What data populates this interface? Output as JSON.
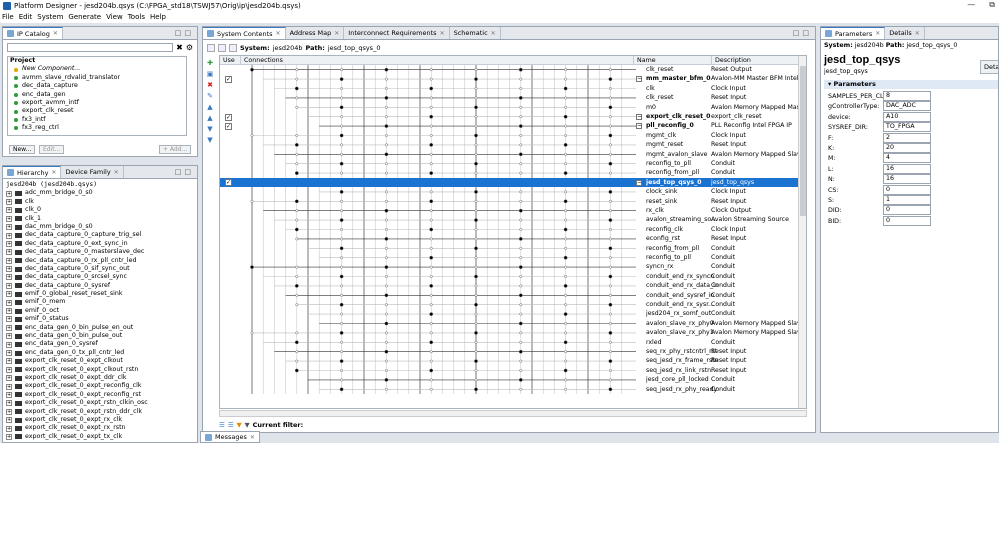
{
  "window": {
    "title": "Platform Designer - jesd204b.qsys (C:\\FPGA_std18\\TSWJ57\\Orig\\ip\\jesd204b.qsys)"
  },
  "menu": [
    "File",
    "Edit",
    "System",
    "Generate",
    "View",
    "Tools",
    "Help"
  ],
  "ip_catalog": {
    "tab": "IP Catalog",
    "search_value": "",
    "project_label": "Project",
    "new_component": "New Component...",
    "items": [
      "avmm_slave_rdvalid_translator",
      "dec_data_capture",
      "enc_data_gen",
      "export_avmm_intf",
      "export_clk_reset",
      "fx3_intf",
      "fx3_reg_ctrl"
    ],
    "buttons": {
      "new": "New...",
      "edit": "Edit...",
      "add": "+ Add..."
    }
  },
  "hierarchy": {
    "tabs": [
      "Hierarchy",
      "Device Family"
    ],
    "root": "jesd204b (jesd204b.qsys)",
    "items": [
      "adc_mm_bridge_0_s0",
      "clk",
      "clk_0",
      "clk_1",
      "dac_mm_bridge_0_s0",
      "dec_data_capture_0_capture_trig_sel",
      "dec_data_capture_0_ext_sync_in",
      "dec_data_capture_0_masterslave_dec",
      "dec_data_capture_0_rx_pll_cntr_led",
      "dec_data_capture_0_sif_sync_out",
      "dec_data_capture_0_srcsel_sync",
      "dec_data_capture_0_sysref",
      "emif_0_global_reset_reset_sink",
      "emif_0_mem",
      "emif_0_oct",
      "emif_0_status",
      "enc_data_gen_0_bin_pulse_en_out",
      "enc_data_gen_0_bin_pulse_out",
      "enc_data_gen_0_sysref",
      "enc_data_gen_0_tx_pll_cntr_led",
      "export_clk_reset_0_expt_clkout",
      "export_clk_reset_0_expt_clkout_rstn",
      "export_clk_reset_0_expt_ddr_clk",
      "export_clk_reset_0_expt_reconfig_clk",
      "export_clk_reset_0_expt_reconfig_rst",
      "export_clk_reset_0_expt_rstn_clkin_osc",
      "export_clk_reset_0_expt_rstn_ddr_clk",
      "export_clk_reset_0_expt_rx_clk",
      "export_clk_reset_0_expt_rx_rstn",
      "export_clk_reset_0_expt_tx_clk"
    ]
  },
  "system_contents": {
    "tabs": [
      "System Contents",
      "Address Map",
      "Interconnect Requirements",
      "Schematic"
    ],
    "system_label": "System:",
    "system_value": "jesd204b",
    "path_label": "Path:",
    "path_value": "jesd_top_qsys_0",
    "columns": {
      "use": "Use",
      "connections": "Connections",
      "name": "Name",
      "description": "Description"
    },
    "rows": [
      {
        "name": "clk_reset",
        "desc": "Reset Output",
        "use": false,
        "bold": false
      },
      {
        "name": "mm_master_bfm_0",
        "desc": "Avalon-MM Master BFM Intel FPGA IP",
        "use": true,
        "bold": true
      },
      {
        "name": "clk",
        "desc": "Clock Input",
        "use": false,
        "bold": false
      },
      {
        "name": "clk_reset",
        "desc": "Reset Input",
        "use": false,
        "bold": false
      },
      {
        "name": "m0",
        "desc": "Avalon Memory Mapped Master",
        "use": false,
        "bold": false
      },
      {
        "name": "export_clk_reset_0",
        "desc": "export_clk_reset",
        "use": true,
        "bold": true
      },
      {
        "name": "pll_reconfig_0",
        "desc": "PLL Reconfig Intel FPGA IP",
        "use": true,
        "bold": true
      },
      {
        "name": "mgmt_clk",
        "desc": "Clock Input",
        "use": false,
        "bold": false
      },
      {
        "name": "mgmt_reset",
        "desc": "Reset Input",
        "use": false,
        "bold": false
      },
      {
        "name": "mgmt_avalon_slave",
        "desc": "Avalon Memory Mapped Slave",
        "use": false,
        "bold": false
      },
      {
        "name": "reconfig_to_pll",
        "desc": "Conduit",
        "use": false,
        "bold": false
      },
      {
        "name": "reconfig_from_pll",
        "desc": "Conduit",
        "use": false,
        "bold": false
      },
      {
        "name": "jesd_top_qsys_0",
        "desc": "jesd_top_qsys",
        "use": true,
        "bold": true,
        "selected": true
      },
      {
        "name": "clock_sink",
        "desc": "Clock Input",
        "use": false,
        "bold": false
      },
      {
        "name": "reset_sink",
        "desc": "Reset Input",
        "use": false,
        "bold": false
      },
      {
        "name": "rx_clk",
        "desc": "Clock Output",
        "use": false,
        "bold": false
      },
      {
        "name": "avalon_streaming_so...",
        "desc": "Avalon Streaming Source",
        "use": false,
        "bold": false
      },
      {
        "name": "reconfig_clk",
        "desc": "Clock Input",
        "use": false,
        "bold": false
      },
      {
        "name": "econfig_rst",
        "desc": "Reset Input",
        "use": false,
        "bold": false
      },
      {
        "name": "reconfig_from_pll",
        "desc": "Conduit",
        "use": false,
        "bold": false
      },
      {
        "name": "reconfig_to_pll",
        "desc": "Conduit",
        "use": false,
        "bold": false
      },
      {
        "name": "syncn_rx",
        "desc": "Conduit",
        "use": false,
        "bold": false
      },
      {
        "name": "conduit_end_rx_syncn",
        "desc": "Conduit",
        "use": false,
        "bold": false
      },
      {
        "name": "conduit_end_rx_data_in",
        "desc": "Conduit",
        "use": false,
        "bold": false
      },
      {
        "name": "conduit_end_sysref_in",
        "desc": "Conduit",
        "use": false,
        "bold": false
      },
      {
        "name": "conduit_end_rx_sysr...",
        "desc": "Conduit",
        "use": false,
        "bold": false
      },
      {
        "name": "jesd204_rx_somf_out",
        "desc": "Conduit",
        "use": false,
        "bold": false
      },
      {
        "name": "avalon_slave_rx_phy0",
        "desc": "Avalon Memory Mapped Slave",
        "use": false,
        "bold": false
      },
      {
        "name": "avalon_slave_rx_phy1",
        "desc": "Avalon Memory Mapped Slave",
        "use": false,
        "bold": false
      },
      {
        "name": "rxled",
        "desc": "Conduit",
        "use": false,
        "bold": false
      },
      {
        "name": "seq_rx_phy_rstcntrl_rst",
        "desc": "Reset Input",
        "use": false,
        "bold": false
      },
      {
        "name": "seq_jesd_rx_frame_rstn",
        "desc": "Reset Input",
        "use": false,
        "bold": false
      },
      {
        "name": "seq_jesd_rx_link_rstn",
        "desc": "Reset Input",
        "use": false,
        "bold": false
      },
      {
        "name": "jesd_core_pll_locked",
        "desc": "Conduit",
        "use": false,
        "bold": false
      },
      {
        "name": "seq_jesd_rx_phy_ready",
        "desc": "Conduit",
        "use": false,
        "bold": false
      }
    ],
    "filter_label": "Current filter:"
  },
  "parameters": {
    "tabs": [
      "Parameters",
      "Details"
    ],
    "system_label": "System:",
    "system_value": "jesd204b",
    "path_label": "Path:",
    "path_value": "jesd_top_qsys_0",
    "title": "jesd_top_qsys",
    "subtitle": "jesd_top_qsys",
    "details_button": "Deta",
    "section": "Parameters",
    "fields": [
      {
        "key": "SAMPLES_PER_CLK:",
        "value": "8"
      },
      {
        "key": "gControllerType:",
        "value": "DAC_ADC"
      },
      {
        "key": "device:",
        "value": "A10"
      },
      {
        "key": "SYSREF_DIR:",
        "value": "TO_FPGA"
      },
      {
        "key": "F:",
        "value": "2"
      },
      {
        "key": "K:",
        "value": "20"
      },
      {
        "key": "M:",
        "value": "4"
      },
      {
        "key": "L:",
        "value": "16"
      },
      {
        "key": "N:",
        "value": "16"
      },
      {
        "key": "CS:",
        "value": "0"
      },
      {
        "key": "S:",
        "value": "1"
      },
      {
        "key": "DID:",
        "value": "0"
      },
      {
        "key": "BID:",
        "value": "0"
      }
    ]
  },
  "messages": {
    "tab": "Messages"
  }
}
